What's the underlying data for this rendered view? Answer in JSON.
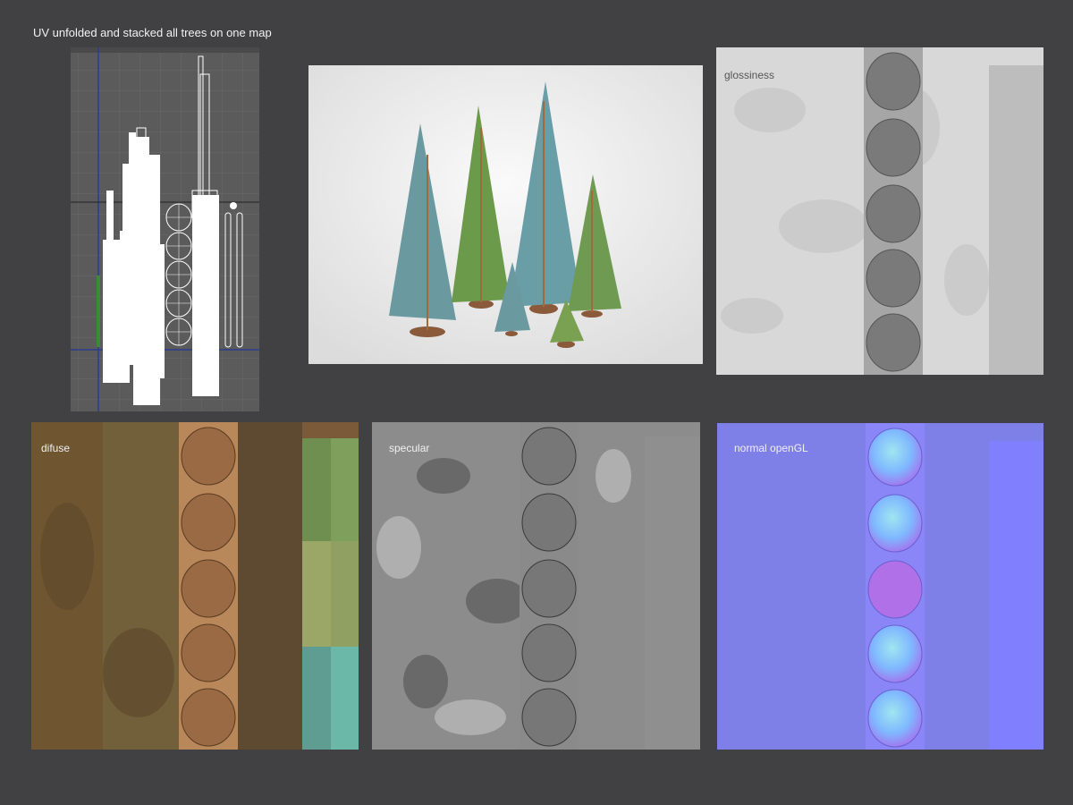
{
  "page": {
    "title": "UV unfolded and stacked all trees on one map"
  },
  "panels": {
    "uv_editor": {
      "name": "uv-editor-view"
    },
    "render": {
      "name": "tree-render"
    },
    "glossiness": {
      "label": "glossiness",
      "tint": "#d6d6d6"
    },
    "diffuse": {
      "label": "difuse",
      "tint": "#6b5634"
    },
    "specular": {
      "label": "specular",
      "tint": "#8c8c8c"
    },
    "normal": {
      "label": "normal openGL",
      "tint": "#8080f0"
    }
  },
  "colors": {
    "background": "#414042",
    "uv_grid": "#5a5a5a",
    "diffuse_swatches": [
      "#6e8f4f",
      "#9aa766",
      "#5f9c92"
    ],
    "normal_flat": "#8080ff"
  }
}
